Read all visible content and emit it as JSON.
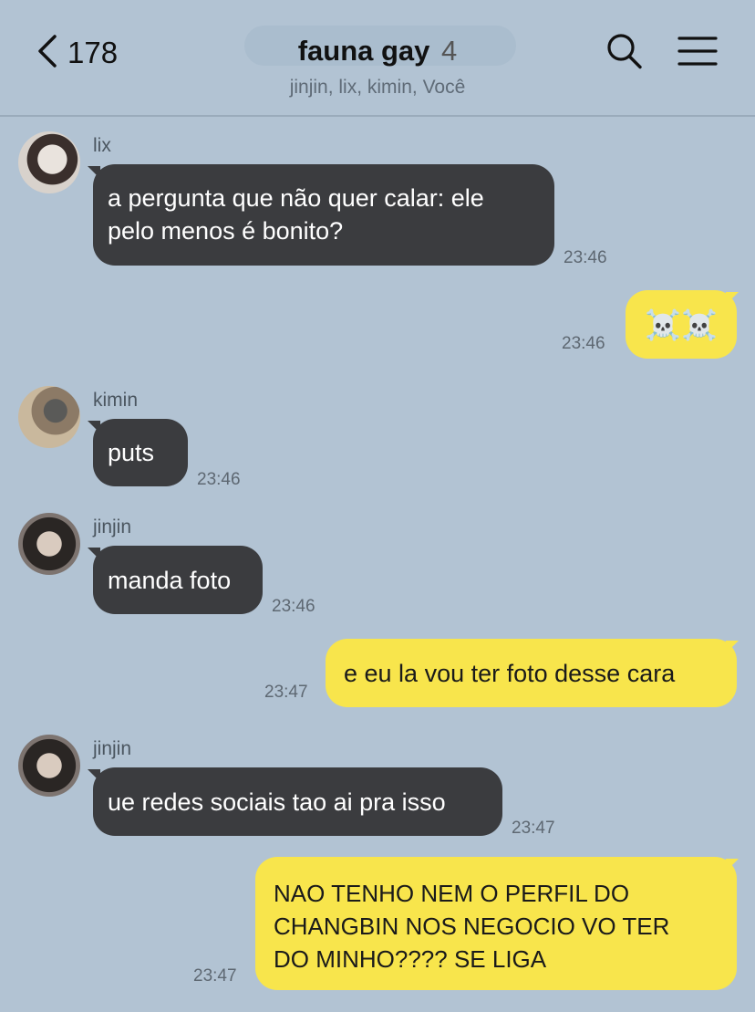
{
  "header": {
    "back_count": "178",
    "title": "fauna gay",
    "member_count": "4",
    "members": "jinjin, lix, kimin, Você"
  },
  "colors": {
    "background": "#b2c3d3",
    "incoming_bubble": "#3b3c3f",
    "outgoing_bubble": "#f8e54c"
  },
  "icons": [
    "chevron-left-icon",
    "search-icon",
    "menu-icon",
    "skull-crossbones-icon"
  ],
  "messages": [
    {
      "sender": "lix",
      "lines": [
        "a pergunta que não quer calar: ele",
        "pelo menos é bonito?"
      ],
      "time": "23:46"
    },
    {
      "sender": "Você",
      "text": "☠️☠️",
      "time": "23:46"
    },
    {
      "sender": "kimin",
      "text": "puts",
      "time": "23:46"
    },
    {
      "sender": "jinjin",
      "text": "manda foto",
      "time": "23:46"
    },
    {
      "sender": "Você",
      "text": "e eu la vou ter foto desse cara",
      "time": "23:47"
    },
    {
      "sender": "jinjin",
      "text": "ue redes sociais tao ai pra isso",
      "time": "23:47"
    },
    {
      "sender": "Você",
      "lines": [
        "NAO TENHO NEM O PERFIL DO",
        "CHANGBIN NOS NEGOCIO VO TER",
        "DO MINHO???? SE LIGA"
      ],
      "time": "23:47"
    }
  ]
}
